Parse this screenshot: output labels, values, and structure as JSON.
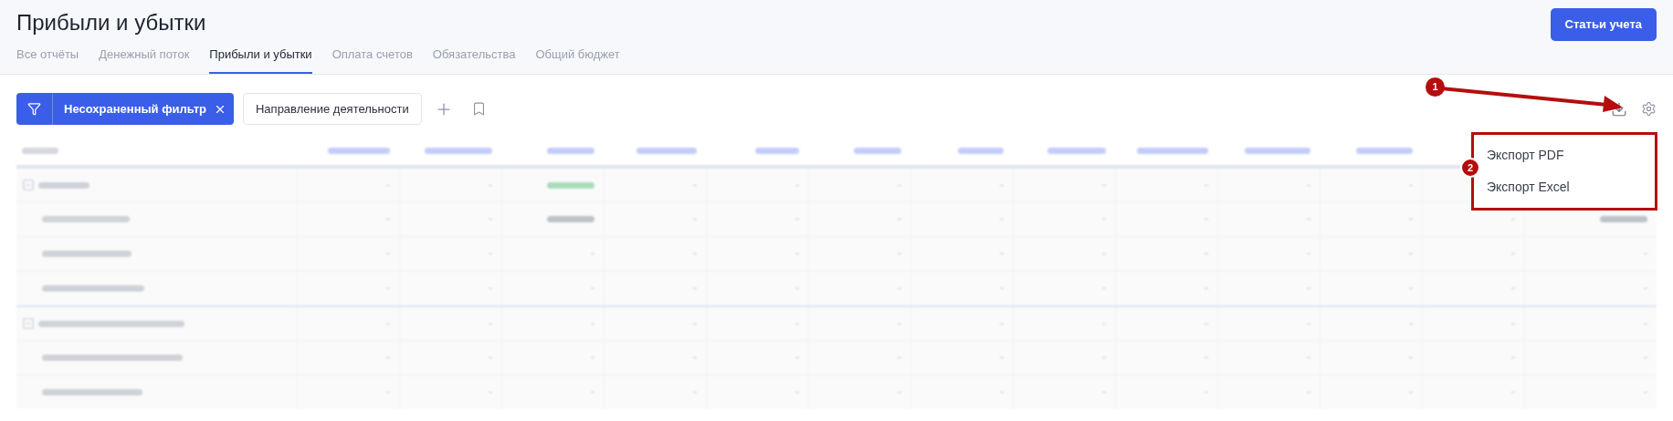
{
  "title": "Прибыли и убытки",
  "tabs": [
    {
      "label": "Все отчёты",
      "selected": false
    },
    {
      "label": "Денежный поток",
      "selected": false
    },
    {
      "label": "Прибыли и убытки",
      "selected": true
    },
    {
      "label": "Оплата счетов",
      "selected": false
    },
    {
      "label": "Обязательства",
      "selected": false
    },
    {
      "label": "Общий бюджет",
      "selected": false
    }
  ],
  "primary_button": "Статьи учета",
  "filter": {
    "label": "Несохраненный фильтр"
  },
  "filter_chip": "Направление деятельности",
  "table": {
    "rows": [
      {
        "kind": "group",
        "amount_in": [
          {
            "kind": "march"
          }
        ]
      },
      {
        "kind": "item",
        "amount_in": [
          {
            "kind": "march"
          },
          {
            "kind": "total"
          }
        ]
      },
      {
        "kind": "item"
      },
      {
        "kind": "item"
      },
      {
        "kind": "group"
      },
      {
        "kind": "item"
      },
      {
        "kind": "item"
      }
    ]
  },
  "export_menu": [
    "Экспорт PDF",
    "Экспорт Excel"
  ],
  "annotations": [
    "1",
    "2"
  ]
}
